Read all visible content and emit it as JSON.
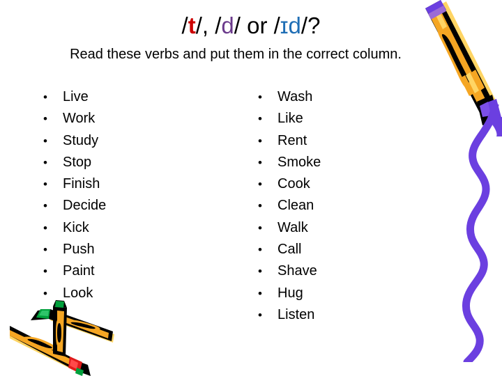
{
  "slide": {
    "title": {
      "full_text": "/t/, /d/ or /ɪd/?",
      "segments": [
        {
          "text": "/",
          "color": "#000000"
        },
        {
          "text": "t",
          "color": "#cc0000"
        },
        {
          "text": "/, /",
          "color": "#000000"
        },
        {
          "text": "d",
          "color": "#6b3a8c"
        },
        {
          "text": "/ or /",
          "color": "#000000"
        },
        {
          "text": "ɪd",
          "color": "#1f6eb5"
        },
        {
          "text": "/?",
          "color": "#000000"
        }
      ],
      "part_t": "t",
      "part_d": "d",
      "part_id": "ɪd",
      "lead_slash": "/",
      "mid_text": "/, /",
      "or_text": "/ or /",
      "tail_text": "/?"
    },
    "instruction": "Read these verbs and put them in the correct column.",
    "columns": {
      "left": {
        "items": [
          "Live",
          "Work",
          "Study",
          "Stop",
          "Finish",
          "Decide",
          "Kick",
          "Push",
          "Paint",
          "Look"
        ]
      },
      "right": {
        "items": [
          "Wash",
          "Like",
          "Rent",
          "Smoke",
          "Cook",
          "Clean",
          "Walk",
          "Call",
          "Shave",
          "Hug",
          "Listen"
        ]
      }
    },
    "decorations": {
      "marker_top_right": "crayon-marker-clipart",
      "squiggle_right": "purple-wavy-line-clipart",
      "crayons_bottom_left": "crossed-crayons-clipart"
    },
    "colors": {
      "background": "#ffffff",
      "text": "#000000",
      "accent_red": "#cc0000",
      "accent_purple": "#6b3a8c",
      "accent_blue": "#1f6eb5",
      "crayon_body": "#f5a623",
      "crayon_body_light": "#ffc94d",
      "crayon_outline": "#000000",
      "squiggle_purple": "#6b3fe0",
      "crayon_tip_green": "#00a03c",
      "crayon_tip_red": "#e01b1b"
    }
  }
}
